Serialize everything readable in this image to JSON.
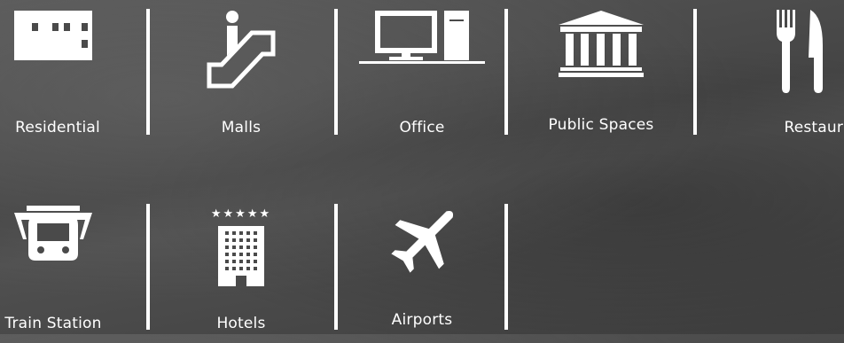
{
  "categories": [
    {
      "label": "Residential",
      "icon": "building-icon"
    },
    {
      "label": "Malls",
      "icon": "escalator-icon"
    },
    {
      "label": "Office",
      "icon": "desktop-computer-icon"
    },
    {
      "label": "Public Spaces",
      "icon": "columns-building-icon"
    },
    {
      "label": "Restaurant",
      "icon": "fork-knife-icon"
    },
    {
      "label": "Train Station",
      "icon": "train-icon"
    },
    {
      "label": "Hotels",
      "icon": "hotel-icon"
    },
    {
      "label": "Airports",
      "icon": "airplane-icon"
    }
  ],
  "hotel_rating": "★★★★★"
}
